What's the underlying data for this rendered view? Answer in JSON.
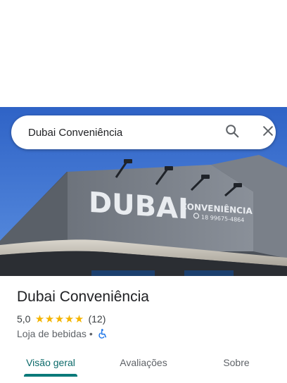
{
  "search": {
    "query": "Dubai Conveniência"
  },
  "hero_photo": {
    "sign_main": "DUBAI",
    "sign_sub": "CONVENIÊNCIA",
    "sign_phone": "18 99675-4864"
  },
  "place": {
    "name": "Dubai Conveniência",
    "rating": "5,0",
    "stars_filled": 5,
    "review_count": "(12)",
    "category": "Loja de bebidas",
    "separator": "•"
  },
  "tabs": [
    {
      "label": "Visão geral",
      "active": true
    },
    {
      "label": "Avaliações",
      "active": false
    },
    {
      "label": "Sobre",
      "active": false
    }
  ],
  "colors": {
    "accent": "#0b7a7a",
    "star": "#f4b400",
    "accessibility": "#1a73e8",
    "sky": "#3b6fd0"
  },
  "icons": {
    "search": "search-icon",
    "close": "close-icon",
    "accessibility": "wheelchair-icon",
    "whatsapp": "whatsapp-icon"
  }
}
